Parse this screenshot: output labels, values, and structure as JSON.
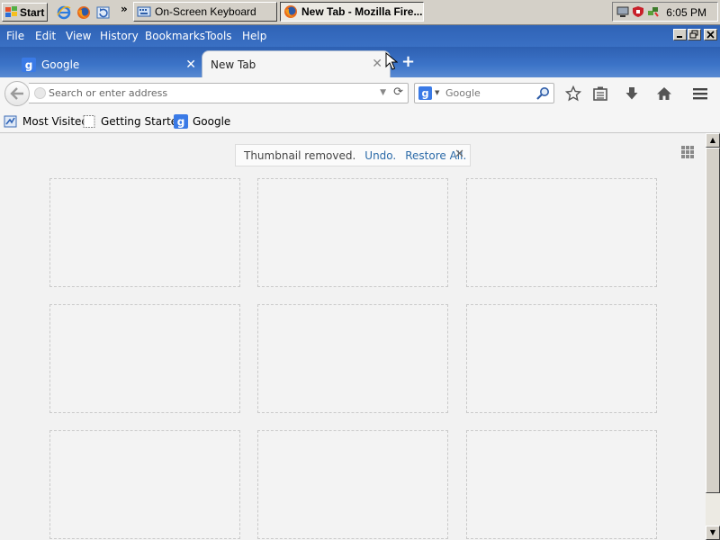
{
  "taskbar": {
    "start_label": "Start",
    "quicklaunch": [
      "ie-icon",
      "firefox-icon",
      "refresh-icon"
    ],
    "chevron": "»",
    "tasks": [
      {
        "label": "On-Screen Keyboard",
        "icon": "keyboard-icon",
        "active": false
      },
      {
        "label": "New Tab - Mozilla Fire...",
        "icon": "firefox-icon",
        "active": true
      }
    ],
    "tray": {
      "clock": "6:05 PM",
      "icons": [
        "tray-monitor-icon",
        "tray-shield-icon",
        "tray-network-icon"
      ]
    }
  },
  "menubar": {
    "items": [
      {
        "label": "File"
      },
      {
        "label": "Edit"
      },
      {
        "label": "View"
      },
      {
        "label": "History"
      },
      {
        "label": "Bookmarks"
      },
      {
        "label": "Tools"
      },
      {
        "label": "Help"
      }
    ],
    "window_controls": [
      "minimize",
      "restore",
      "close"
    ]
  },
  "tabs": [
    {
      "label": "Google",
      "icon": "google-icon",
      "close": "✕"
    },
    {
      "label": "New Tab",
      "close": "✕",
      "selected": true
    }
  ],
  "new_tab_button": "+",
  "navbar": {
    "url_placeholder": "Search or enter address",
    "url_value": "",
    "search_engine": "google-icon",
    "search_placeholder": "Google",
    "tools": [
      "bookmark-star-icon",
      "reading-list-icon",
      "downloads-icon",
      "home-icon",
      "menu-icon"
    ]
  },
  "bookmarks": [
    {
      "label": "Most Visited",
      "icon": "most-visited-icon"
    },
    {
      "label": "Getting Started",
      "icon": "page-icon"
    },
    {
      "label": "Google",
      "icon": "google-icon"
    }
  ],
  "content": {
    "notice": {
      "text": "Thumbnail removed.",
      "undo": "Undo.",
      "restore_all": "Restore All.",
      "close": "✕"
    },
    "thumbnail_count": 9
  },
  "colors": {
    "tabstrip_blue": "#3a6ec2",
    "link": "#2b6aa8",
    "taskbar_gray": "#d4d0c8"
  }
}
